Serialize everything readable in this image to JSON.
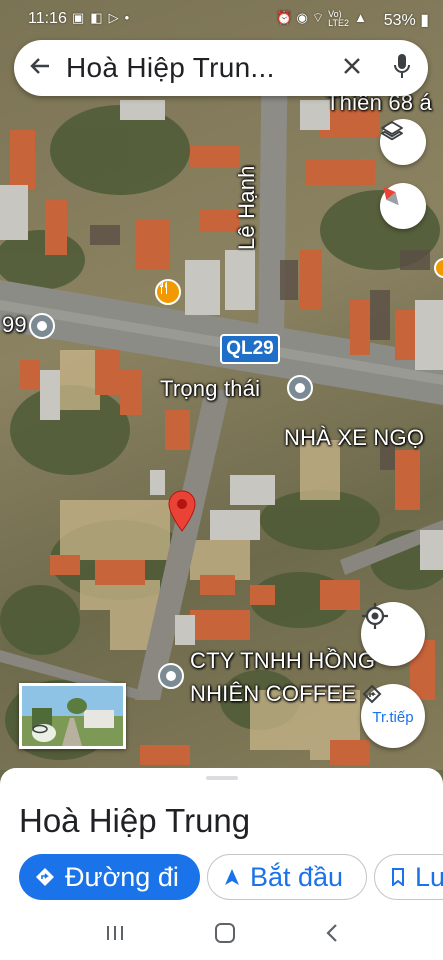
{
  "status_bar": {
    "time": "11:16",
    "battery": "53%",
    "network": "Vo) LTE2"
  },
  "search": {
    "query": "Hoà Hiệp Trun..."
  },
  "map": {
    "labels": {
      "thien": "Thiên 68 á",
      "le_hanh": "Lê Hạnh",
      "ninety_nine": "99",
      "road": "QL29",
      "trong_thai": "Trọng thái",
      "nha_xe": "NHÀ XE NGỌ",
      "cty_line1": "CTY TNHH HỒNG",
      "cty_line2": "NHIÊN COFFEE"
    },
    "nav_button_label": "Tr.tiếp"
  },
  "sheet": {
    "place_name": "Hoà Hiệp Trung",
    "chips": {
      "directions": "Đường đi",
      "start": "Bắt đầu",
      "save": "Lư"
    }
  },
  "colors": {
    "accent": "#1a73e8",
    "pin": "#ea4335",
    "road_badge": "#1f6fc9",
    "restaurant": "#f29900"
  },
  "icons": [
    "back-arrow-icon",
    "close-icon",
    "mic-icon",
    "layers-icon",
    "compass-icon",
    "my-location-icon",
    "navigate-icon",
    "directions-icon",
    "navigation-arrow-icon",
    "bookmark-icon",
    "restaurant-icon",
    "place-marker-icon",
    "red-pin-icon"
  ]
}
